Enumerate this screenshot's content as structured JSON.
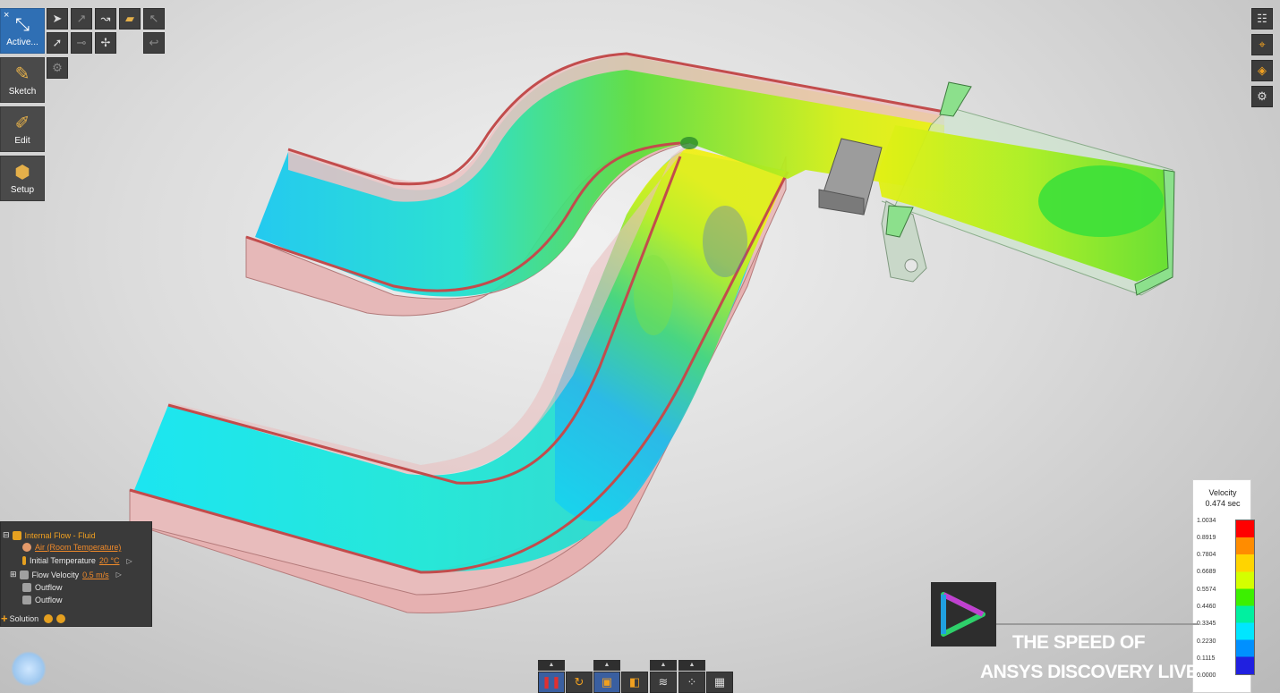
{
  "left_toolbar": {
    "close_label": "×",
    "tools": [
      {
        "label": "Active..."
      },
      {
        "label": "Sketch"
      },
      {
        "label": "Edit"
      },
      {
        "label": "Setup"
      }
    ]
  },
  "tree": {
    "root_label": "Internal Flow - Fluid",
    "material_link": "Air (Room Temperature)",
    "temperature_label": "Initial Temperature",
    "temperature_value": "20 °C",
    "velocity_label": "Flow Velocity",
    "velocity_value": "0.5 m/s",
    "outflow1": "Outflow",
    "outflow2": "Outflow",
    "solution_label": "Solution"
  },
  "legend": {
    "title": "Velocity",
    "time": "0.474 sec",
    "values": [
      "1.0034",
      "0.8919",
      "0.7804",
      "0.6689",
      "0.5574",
      "0.4460",
      "0.3345",
      "0.2230",
      "0.1115",
      "0.0000"
    ],
    "colors": [
      "#ff0000",
      "#ff8c00",
      "#ffd400",
      "#d4ff00",
      "#3cf000",
      "#00f0a0",
      "#00e6ff",
      "#0090ff",
      "#2020e0"
    ]
  },
  "watermark": {
    "line1": "THE SPEED OF",
    "line2": "ANSYS DISCOVERY LIVE"
  },
  "bottom_toolbar": {
    "tab_label": "▲"
  }
}
